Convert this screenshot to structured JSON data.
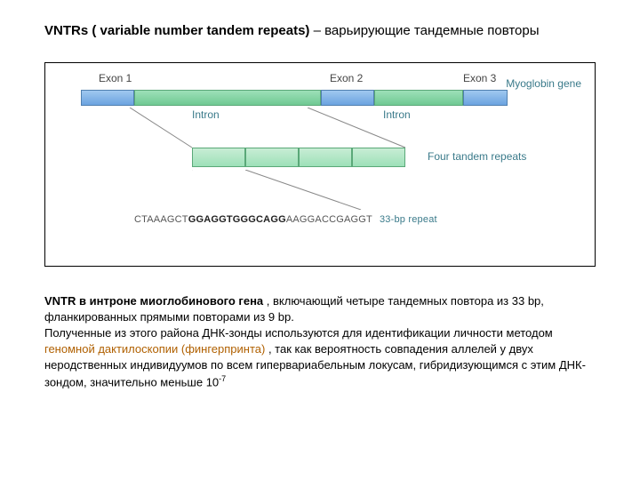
{
  "title_bold": "VNTRs ( variable number tandem repeats) ",
  "title_rest": "– варьирующие тандемные повторы",
  "exons": [
    "Exon 1",
    "Exon 2",
    "Exon 3"
  ],
  "introns": [
    "Intron",
    "Intron"
  ],
  "gene_label": "Myoglobin gene",
  "repeats_label": "Four tandem repeats",
  "seq_pre": "CTAAAGCT",
  "seq_bold": "GGAGGTGGGCAGG",
  "seq_post": "AAGGACCGAGGT",
  "seq_label": "33-bp repeat",
  "cap1_bold": "VNTR в интроне миоглобинового гена ",
  "cap1_rest": ", включающий четыре тандемных повтора из 33 bp,",
  "cap2": "фланкированных прямыми повторами из 9 bp.",
  "cap3": "Полученные из этого района ДНК-зонды используются для идентификации личности методом ",
  "cap4_hl": "геномной дактилоскопии (фингерпринта) ",
  "cap4_rest": ", так как вероятность совпадения аллелей у двух неродственных индивидуумов по всем гипервариабельным локусам, гибридизующимся с этим ДНК-зондом, значительно меньше 10",
  "cap4_sup": "-7"
}
